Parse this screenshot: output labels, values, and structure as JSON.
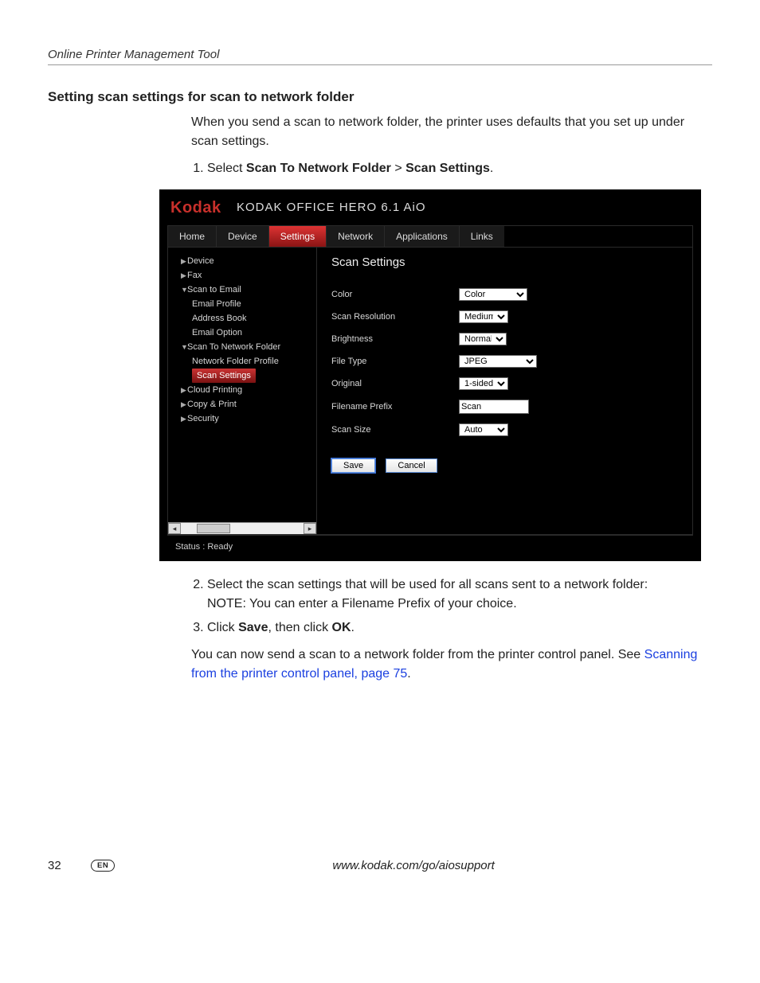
{
  "running_head": "Online Printer Management Tool",
  "section_heading": "Setting scan settings for scan to network folder",
  "intro": "When you send a scan to network folder, the printer uses defaults that you set up under scan settings.",
  "step1_prefix": "Select ",
  "step1_b1": "Scan To Network Folder",
  "step1_sep": " > ",
  "step1_b2": "Scan Settings",
  "step1_suffix": ".",
  "step2": "Select the scan settings that will be used for all scans sent to a network folder:",
  "step2_note": "NOTE: You can enter a Filename Prefix of your choice.",
  "step3_prefix": "Click ",
  "step3_b1": "Save",
  "step3_mid": ", then click ",
  "step3_b2": "OK",
  "step3_suffix": ".",
  "closing": "You can now send a scan to a network folder from the printer control panel. See ",
  "closing_link": "Scanning from the printer control panel, page 75",
  "closing_suffix": ".",
  "page_number": "32",
  "lang_badge": "EN",
  "footer_url": "www.kodak.com/go/aiosupport",
  "shot": {
    "brand": "Kodak",
    "model": "KODAK OFFICE HERO 6.1 AiO",
    "tabs": [
      "Home",
      "Device",
      "Settings",
      "Network",
      "Applications",
      "Links"
    ],
    "active_tab_index": 2,
    "sidebar": {
      "device": "Device",
      "fax": "Fax",
      "scan_to_email": "Scan to Email",
      "email_profile": "Email Profile",
      "address_book": "Address Book",
      "email_option": "Email Option",
      "scan_to_network_folder": "Scan To Network Folder",
      "network_folder_profile": "Network Folder Profile",
      "scan_settings": "Scan Settings",
      "cloud_printing": "Cloud Printing",
      "copy_print": "Copy & Print",
      "security": "Security"
    },
    "panel_title": "Scan Settings",
    "fields": {
      "color_label": "Color",
      "color_value": "Color",
      "resolution_label": "Scan Resolution",
      "resolution_value": "Medium",
      "brightness_label": "Brightness",
      "brightness_value": "Normal",
      "filetype_label": "File Type",
      "filetype_value": "JPEG",
      "original_label": "Original",
      "original_value": "1-sided",
      "prefix_label": "Filename Prefix",
      "prefix_value": "Scan",
      "size_label": "Scan Size",
      "size_value": "Auto"
    },
    "buttons": {
      "save": "Save",
      "cancel": "Cancel"
    },
    "status": "Status : Ready"
  }
}
